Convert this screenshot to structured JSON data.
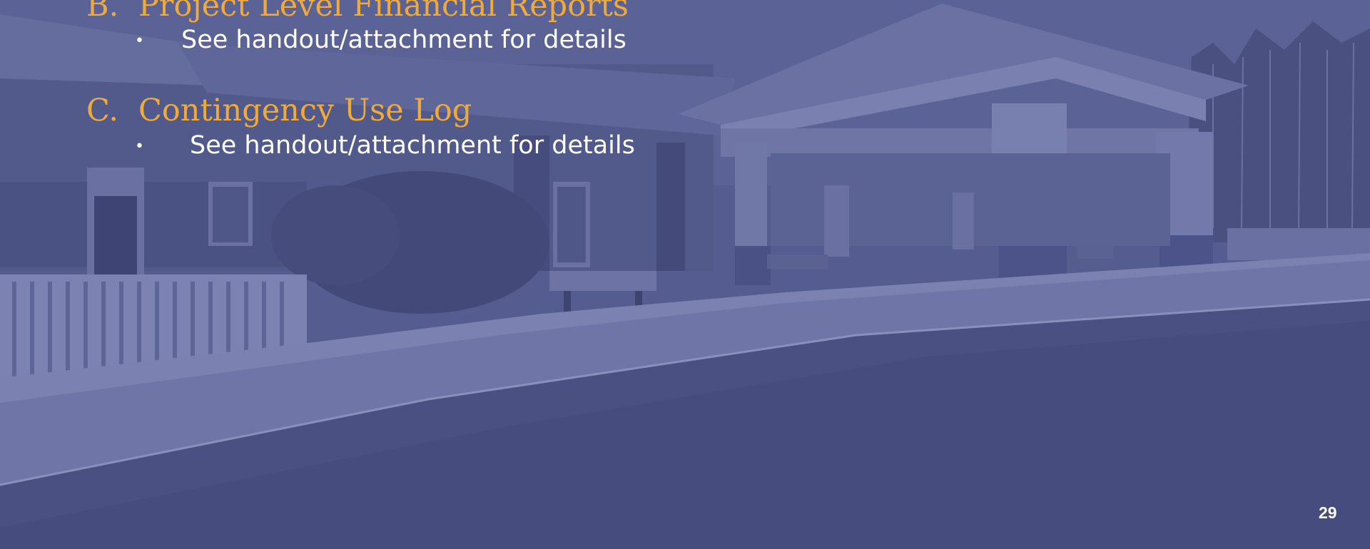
{
  "slide": {
    "sections": [
      {
        "letter": "B.",
        "title": "Project Level Financial Reports",
        "bullet": "See handout/attachment for details"
      },
      {
        "letter": "C.",
        "title": "Contingency Use Log",
        "bullet": "See handout/attachment for details"
      }
    ],
    "bullet_symbol": "•",
    "page_number": "29"
  },
  "colors": {
    "background": "#4e5585",
    "heading": "#f0aa3a",
    "body_text": "#ffffff"
  }
}
